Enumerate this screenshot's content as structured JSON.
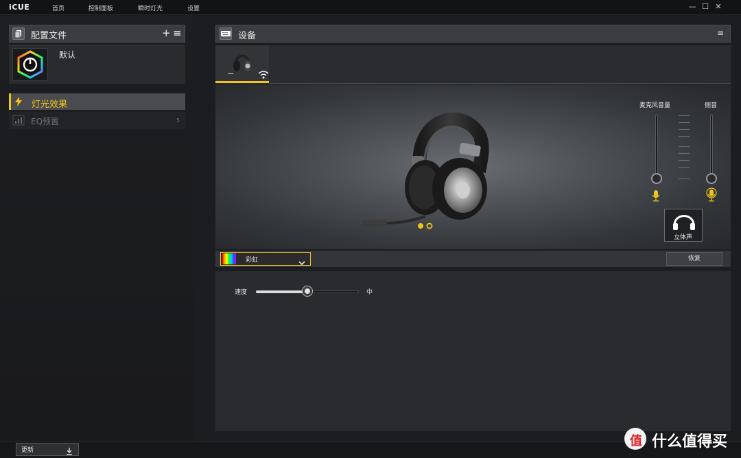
{
  "app": {
    "name": "iCUE"
  },
  "nav": {
    "items": [
      "首页",
      "控制面板",
      "瞬时灯光",
      "设置"
    ]
  },
  "window": {
    "minimize": "—",
    "maximize": "☐",
    "close": "✕"
  },
  "profiles": {
    "title": "配置文件",
    "add": "+",
    "menu": "≡",
    "items": [
      {
        "name": "默认"
      }
    ]
  },
  "features": [
    {
      "label": "灯光效果",
      "count": "",
      "selected": true
    },
    {
      "label": "EQ预置",
      "count": "5",
      "selected": false
    }
  ],
  "devices": {
    "title": "设备",
    "menu": "≡"
  },
  "preview": {
    "mic_volume_label": "麦克风音量",
    "sidetone_label": "侧音",
    "stereo_label": "立体声"
  },
  "effect": {
    "selected": "彩虹",
    "reset_label": "恢复"
  },
  "speed": {
    "label": "速度",
    "value_label": "中",
    "level": 0.5
  },
  "bottom": {
    "update_label": "更新"
  },
  "watermark": {
    "icon_char": "值",
    "text": "什么值得买"
  },
  "colors": {
    "accent": "#f0c419",
    "background": "#1c1d20",
    "panel_header": "#3b3c40"
  }
}
